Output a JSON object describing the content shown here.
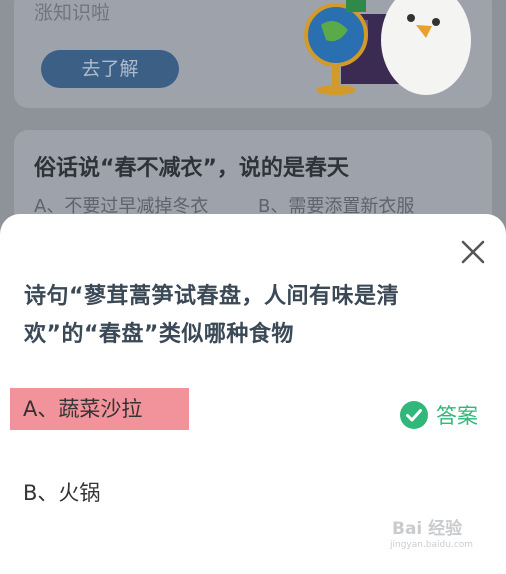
{
  "background": {
    "card1_text": "涨知识啦",
    "card1_button": "去了解",
    "card2_question": "俗话说“春不减衣”，说的是春天",
    "card2_option_a": "A、不要过早减掉冬衣",
    "card2_option_b": "B、需要添置新衣服"
  },
  "modal": {
    "question": "诗句“蓼茸蒿笋试春盘，人间有味是清欢”的“春盘”类似哪种食物",
    "options": [
      {
        "label": "A、蔬菜沙拉",
        "highlighted": true
      },
      {
        "label": "B、火锅",
        "highlighted": false
      }
    ],
    "answer_label": "答案",
    "close_icon": "close-icon",
    "check_icon": "check-circle-icon"
  },
  "watermark": {
    "brand": "Bai 经验",
    "sub": "jingyan.baidu.com"
  },
  "colors": {
    "answer_green": "#2fb87a",
    "highlight_pink": "#f2929a",
    "question_text": "#3b4856"
  }
}
